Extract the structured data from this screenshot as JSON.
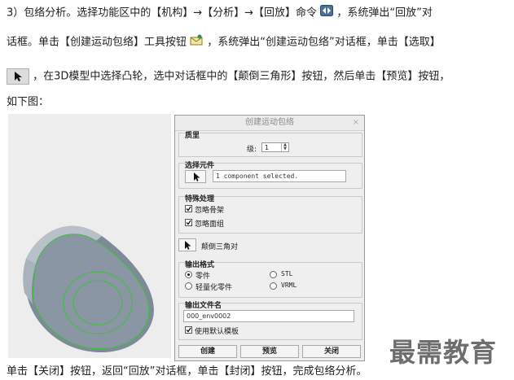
{
  "instructions": {
    "line1": "3）包络分析。选择功能区中的【机构】→【分析】→【回放】命令",
    "line1_end": "，系统弹出“回放”对",
    "line2": "话框。单击【创建运动包络】工具按钮",
    "line2_end": "，系统弹出“创建运动包络”对话框，单击【选取】",
    "line3": "，在3D模型中选择凸轮，选中对话框中的【颠倒三角形】按钮，然后单击【预览】按钮，",
    "line4": "如下图：",
    "footer": "单击【关闭】按钮，返回“回放”对话框，单击【封闭】按钮，完成包络分析。"
  },
  "dialog": {
    "title": "创建运动包络",
    "close": "×",
    "quality": {
      "heading": "质里",
      "level_label": "级:",
      "level_value": "1"
    },
    "select_component": {
      "heading": "选择元件",
      "status": "1 component selected."
    },
    "special": {
      "heading": "特殊处理",
      "ignore_skeleton": "忽略骨架",
      "ignore_faces": "忽略面组"
    },
    "flip_triangle": "颠倒三角对",
    "output_format": {
      "heading": "输出格式",
      "part": "零件",
      "lightweight_part": "轻量化零件",
      "stl": "STL",
      "vrml": "VRML"
    },
    "output_name": {
      "heading": "输出文件名",
      "value": "000_env0002",
      "use_default_template": "使用默认模板"
    },
    "buttons": {
      "create": "创建",
      "preview": "预览",
      "close": "关闭"
    }
  },
  "watermark": "最需教育"
}
